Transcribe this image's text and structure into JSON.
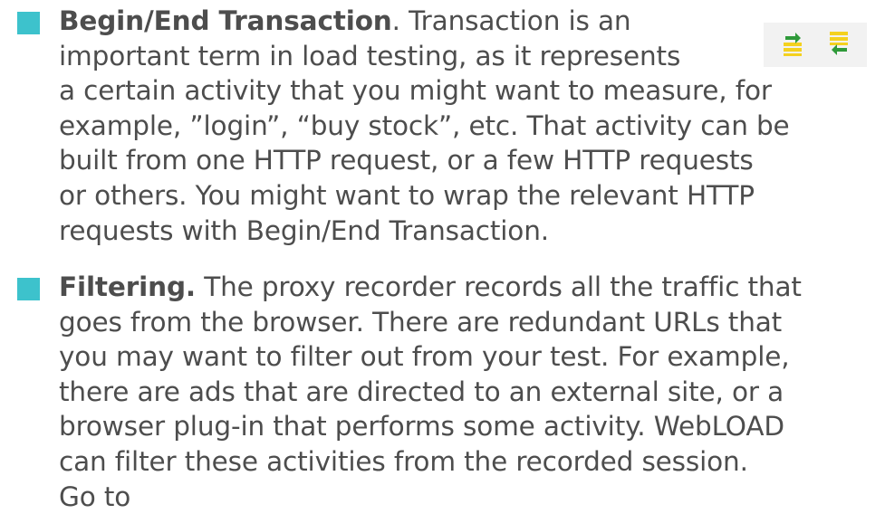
{
  "colors": {
    "bullet": "#3dc2cc",
    "text": "#4d4d4d",
    "toolbar_bg": "#f2f2f2",
    "icon_yellow": "#f4d11f",
    "icon_green": "#2f9a3a"
  },
  "items": [
    {
      "title": "Begin/End Transaction",
      "lines": [
        ". Transaction is an",
        "important term in load testing, as it represents",
        "a certain activity that you might want to measure, for",
        "example, ”login”, “buy stock”, etc. That activity can be",
        "built from one HTTP request, or a few HTTP requests",
        "or others. You might want to wrap the relevant HTTP",
        "requests with Begin/End Transaction."
      ]
    },
    {
      "title": "Filtering.",
      "lines": [
        " The proxy recorder records all the traffic that",
        "goes from the browser. There are redundant URLs that",
        "you may want to filter out from your test. For example,",
        "there are ads that are directed to an external site, or a",
        "browser plug-in that performs some activity. WebLOAD",
        "can filter these activities from the recorded session.",
        "Go to"
      ]
    }
  ],
  "toolbar": {
    "icons": [
      "begin-transaction-icon",
      "end-transaction-icon"
    ]
  }
}
